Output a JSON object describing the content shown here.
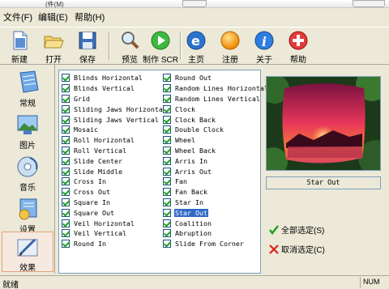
{
  "titlebar": {
    "partial_menu_text": "(件(M)"
  },
  "menubar": {
    "items": [
      "文件(F)",
      "编辑(E)",
      "帮助(H)"
    ]
  },
  "toolbar": {
    "buttons": [
      {
        "label": "新建",
        "icon": "new-file-icon"
      },
      {
        "label": "打开",
        "icon": "folder-open-icon"
      },
      {
        "label": "保存",
        "icon": "floppy-disk-icon"
      },
      {
        "label": "预览",
        "icon": "magnifier-icon"
      },
      {
        "label": "制作 SCR",
        "icon": "play-icon"
      },
      {
        "label": "主页",
        "icon": "globe-e-icon"
      },
      {
        "label": "注册",
        "icon": "orange-ball-icon"
      },
      {
        "label": "关于",
        "icon": "info-icon"
      },
      {
        "label": "帮助",
        "icon": "help-cross-icon"
      }
    ]
  },
  "sidebar": {
    "items": [
      {
        "label": "常规",
        "icon": "document-gear-icon"
      },
      {
        "label": "图片",
        "icon": "picture-icon"
      },
      {
        "label": "音乐",
        "icon": "cd-music-icon"
      },
      {
        "label": "设置",
        "icon": "settings-icon"
      },
      {
        "label": "效果",
        "icon": "pen-effects-icon"
      }
    ],
    "active": "效果"
  },
  "effects": {
    "left": [
      "Blinds Horizontal",
      "Blinds Vertical",
      "Grid",
      "Sliding Jaws Horizontal",
      "Sliding Jaws Vertical",
      "Mosaic",
      "Roll Horizontal",
      "Roll Vertical",
      "Slide Center",
      "Slide Middle",
      "Cross In",
      "Cross Out",
      "Square In",
      "Square Out",
      "Veil Horizontal",
      "Veil Vertical",
      "Round In"
    ],
    "right": [
      "Round Out",
      "Random Lines Horizontal",
      "Random Lines Vertical",
      "Clock",
      "Clock Back",
      "Double Clock",
      "Wheel",
      "Wheel Back",
      "Arris In",
      "Arris Out",
      "Fan",
      "Fan Back",
      "Star In",
      "Star Out",
      "Coalition",
      "Abruption",
      "Slide From Corner"
    ],
    "selected": "Star Out"
  },
  "preview": {
    "label": "Star Out"
  },
  "actions": {
    "select_all": "全部选定(S)",
    "deselect_all": "取消选定(C)"
  },
  "status": {
    "text": "就绪",
    "panel": "NUM"
  },
  "colors": {
    "accent": "#316ac5",
    "check": "#21a121",
    "window": "#ECE9D8"
  }
}
